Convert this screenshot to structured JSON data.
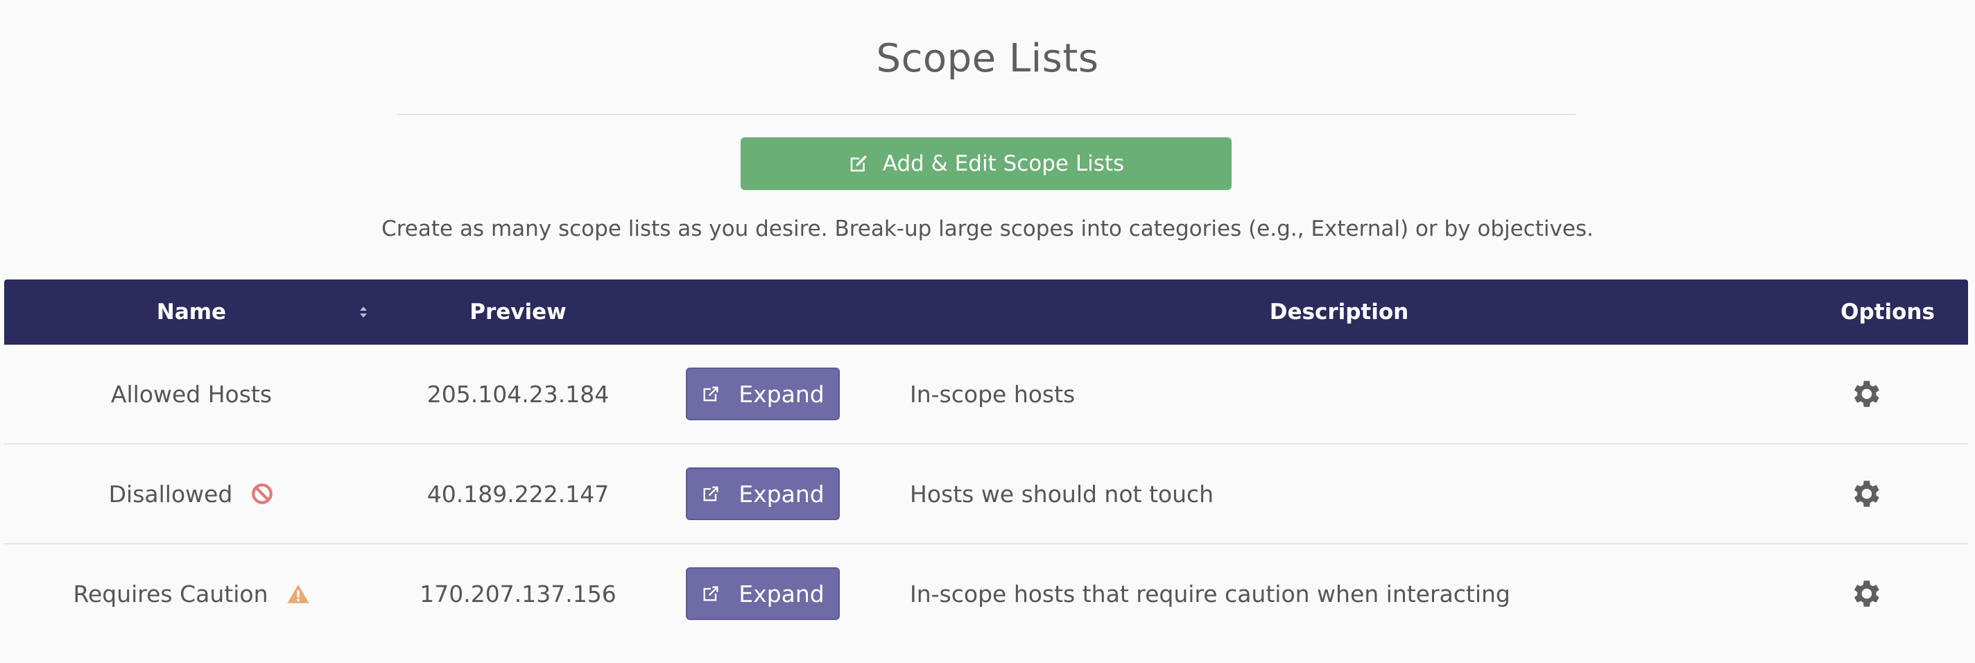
{
  "page": {
    "title": "Scope Lists",
    "add_button_label": "Add & Edit Scope Lists",
    "add_button_icon": "edit-icon",
    "subtitle": "Create as many scope lists as you desire. Break-up large scopes into categories (e.g., External) or by objectives."
  },
  "colors": {
    "header_bg": "#2c2b5e",
    "add_button": "#6aaf75",
    "expand_button": "#6e6ba6",
    "disallowed_icon": "#e07b7b",
    "caution_icon": "#e8a973",
    "gear_icon": "#5f5f5f"
  },
  "table": {
    "headers": {
      "name": "Name",
      "preview": "Preview",
      "description": "Description",
      "options": "Options"
    },
    "rows": [
      {
        "name": "Allowed Hosts",
        "status_icon": "",
        "preview": "205.104.23.184",
        "expand_label": "Expand",
        "description": "In-scope hosts"
      },
      {
        "name": "Disallowed",
        "status_icon": "ban-icon",
        "preview": "40.189.222.147",
        "expand_label": "Expand",
        "description": "Hosts we should not touch"
      },
      {
        "name": "Requires Caution",
        "status_icon": "warning-icon",
        "preview": "170.207.137.156",
        "expand_label": "Expand",
        "description": "In-scope hosts that require caution when interacting"
      }
    ]
  }
}
